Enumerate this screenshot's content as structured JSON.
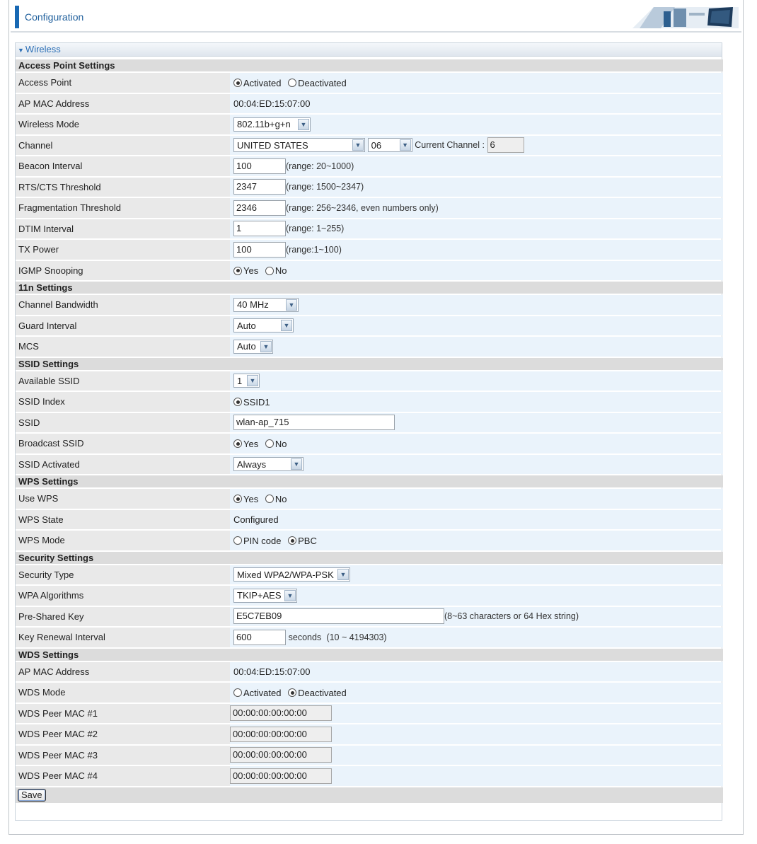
{
  "header": {
    "title": "Configuration"
  },
  "panel": {
    "title": "Wireless"
  },
  "sections": {
    "ap": "Access Point Settings",
    "n11": "11n Settings",
    "ssid": "SSID Settings",
    "wps": "WPS Settings",
    "security": "Security Settings",
    "wds": "WDS Settings"
  },
  "ap": {
    "access_point": {
      "label": "Access Point",
      "opt1": "Activated",
      "opt2": "Deactivated",
      "selected": "Activated"
    },
    "mac": {
      "label": "AP MAC Address",
      "value": "00:04:ED:15:07:00"
    },
    "mode": {
      "label": "Wireless Mode",
      "value": "802.11b+g+n"
    },
    "channel": {
      "label": "Channel",
      "country": "UNITED STATES",
      "number": "06",
      "current_label": "Current Channel :",
      "current_value": "6"
    },
    "beacon": {
      "label": "Beacon Interval",
      "value": "100",
      "hint": "(range: 20~1000)"
    },
    "rts": {
      "label": "RTS/CTS Threshold",
      "value": "2347",
      "hint": "(range: 1500~2347)"
    },
    "frag": {
      "label": "Fragmentation Threshold",
      "value": "2346",
      "hint": "(range: 256~2346, even numbers only)"
    },
    "dtim": {
      "label": "DTIM Interval",
      "value": "1",
      "hint": "(range: 1~255)"
    },
    "tx": {
      "label": "TX Power",
      "value": "100",
      "hint": "(range:1~100)"
    },
    "igmp": {
      "label": "IGMP Snooping",
      "opt1": "Yes",
      "opt2": "No",
      "selected": "Yes"
    }
  },
  "n11": {
    "bandwidth": {
      "label": "Channel Bandwidth",
      "value": "40 MHz"
    },
    "guard": {
      "label": "Guard Interval",
      "value": "Auto"
    },
    "mcs": {
      "label": "MCS",
      "value": "Auto"
    }
  },
  "ssid": {
    "available": {
      "label": "Available SSID",
      "value": "1"
    },
    "index": {
      "label": "SSID Index",
      "opt1": "SSID1"
    },
    "name": {
      "label": "SSID",
      "value": "wlan-ap_715"
    },
    "broadcast": {
      "label": "Broadcast SSID",
      "opt1": "Yes",
      "opt2": "No",
      "selected": "Yes"
    },
    "activated": {
      "label": "SSID Activated",
      "value": "Always"
    }
  },
  "wps": {
    "use": {
      "label": "Use WPS",
      "opt1": "Yes",
      "opt2": "No",
      "selected": "Yes"
    },
    "state": {
      "label": "WPS State",
      "value": "Configured"
    },
    "mode": {
      "label": "WPS Mode",
      "opt1": "PIN code",
      "opt2": "PBC",
      "selected": "PBC"
    }
  },
  "security": {
    "type": {
      "label": "Security Type",
      "value": "Mixed WPA2/WPA-PSK"
    },
    "algo": {
      "label": "WPA Algorithms",
      "value": "TKIP+AES"
    },
    "psk": {
      "label": "Pre-Shared Key",
      "value": "E5C7EB09",
      "hint": "(8~63 characters or 64 Hex string)"
    },
    "renewal": {
      "label": "Key Renewal Interval",
      "value": "600",
      "unit": "seconds",
      "hint": "(10 ~ 4194303)"
    }
  },
  "wds": {
    "mac": {
      "label": "AP MAC Address",
      "value": "00:04:ED:15:07:00"
    },
    "mode": {
      "label": "WDS Mode",
      "opt1": "Activated",
      "opt2": "Deactivated",
      "selected": "Deactivated"
    },
    "peer1": {
      "label": "WDS Peer MAC #1",
      "value": "00:00:00:00:00:00"
    },
    "peer2": {
      "label": "WDS Peer MAC #2",
      "value": "00:00:00:00:00:00"
    },
    "peer3": {
      "label": "WDS Peer MAC #3",
      "value": "00:00:00:00:00:00"
    },
    "peer4": {
      "label": "WDS Peer MAC #4",
      "value": "00:00:00:00:00:00"
    }
  },
  "buttons": {
    "save": "Save"
  },
  "colors": {
    "accent": "#1868b3",
    "value_bg": "#eaf3fb",
    "label_bg": "#e9e9e9",
    "section_bg": "#dcdcdc"
  }
}
